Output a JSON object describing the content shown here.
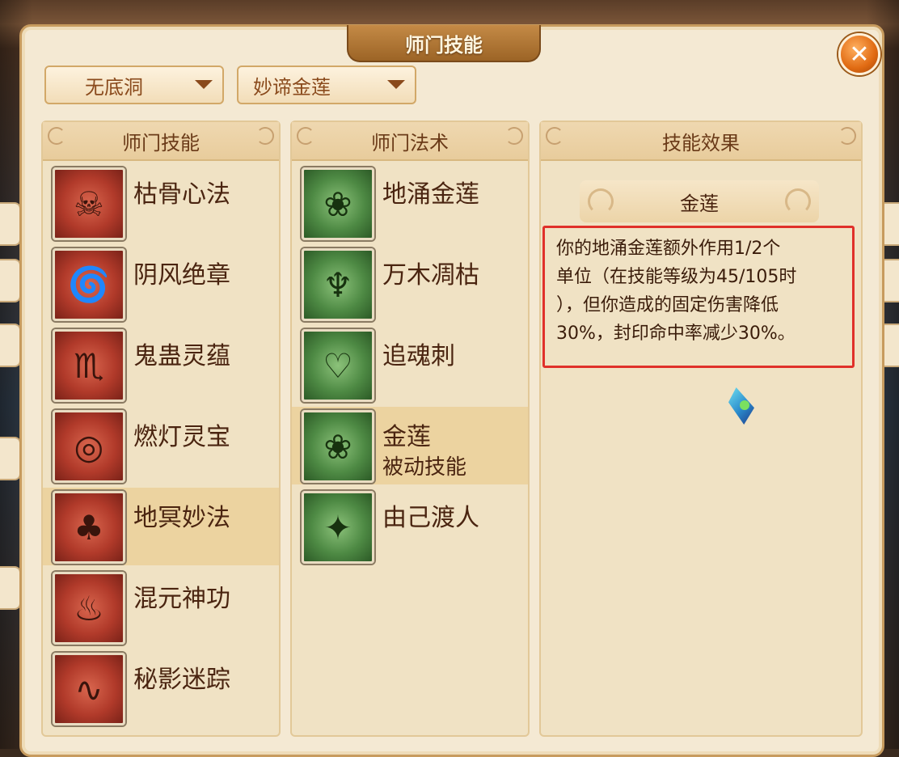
{
  "window": {
    "title": "师门技能",
    "close_icon": "close-icon"
  },
  "filters": {
    "faction": "无底洞",
    "subset": "妙谛金莲"
  },
  "columns": {
    "skills_header": "师门技能",
    "spells_header": "师门法术",
    "effect_header": "技能效果"
  },
  "skills": [
    {
      "name": "枯骨心法",
      "icon": "skeleton-sword-icon",
      "selected": false
    },
    {
      "name": "阴风绝章",
      "icon": "whirlwind-icon",
      "selected": false
    },
    {
      "name": "鬼蛊灵蕴",
      "icon": "scorpion-icon",
      "selected": false
    },
    {
      "name": "燃灯灵宝",
      "icon": "coin-seal-icon",
      "selected": false
    },
    {
      "name": "地冥妙法",
      "icon": "mushroom-icon",
      "selected": true
    },
    {
      "name": "混元神功",
      "icon": "cauldron-icon",
      "selected": false
    },
    {
      "name": "秘影迷踪",
      "icon": "smoke-swirl-icon",
      "selected": false
    }
  ],
  "spells": [
    {
      "name": "地涌金莲",
      "sub": "",
      "icon": "lotus-icon",
      "selected": false
    },
    {
      "name": "万木凋枯",
      "sub": "",
      "icon": "withered-tree-icon",
      "selected": false
    },
    {
      "name": "追魂刺",
      "sub": "",
      "icon": "pierced-heart-icon",
      "selected": false
    },
    {
      "name": "金莲",
      "sub": "被动技能",
      "icon": "lotus-icon",
      "selected": true
    },
    {
      "name": "由己渡人",
      "sub": "",
      "icon": "sparkle-hand-icon",
      "selected": false
    }
  ],
  "effect": {
    "title": "金莲",
    "lines": [
      "你的地涌金莲额外作用1/2个",
      "单位（在技能等级为45/105时",
      "），但你造成的固定伤害降低",
      "30%，封印命中率减少30%。"
    ],
    "highlight_color": "#e0302a"
  },
  "glyphs": {
    "skeleton-sword-icon": "☠",
    "whirlwind-icon": "🌀",
    "scorpion-icon": "♏",
    "coin-seal-icon": "◎",
    "mushroom-icon": "♣",
    "cauldron-icon": "♨",
    "smoke-swirl-icon": "∿",
    "lotus-icon": "❀",
    "withered-tree-icon": "♆",
    "pierced-heart-icon": "♡",
    "sparkle-hand-icon": "✦"
  }
}
